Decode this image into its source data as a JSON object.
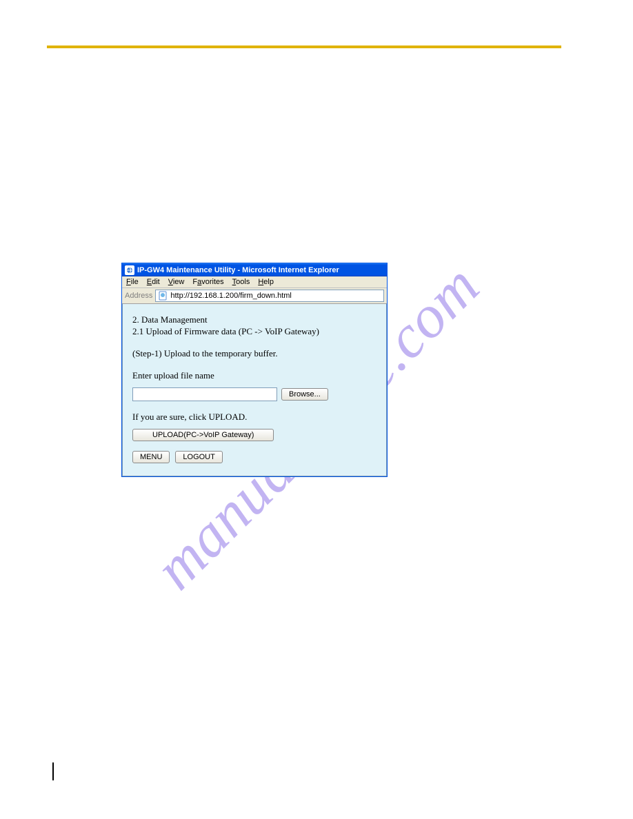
{
  "window": {
    "title": "IP-GW4 Maintenance Utility - Microsoft Internet Explorer"
  },
  "menubar": {
    "file": "File",
    "edit": "Edit",
    "view": "View",
    "favorites": "Favorites",
    "tools": "Tools",
    "help": "Help"
  },
  "addressbar": {
    "label": "Address",
    "url": "http://192.168.1.200/firm_down.html"
  },
  "page": {
    "heading1": "2. Data Management",
    "heading2": "2.1 Upload of Firmware data (PC -> VoIP Gateway)",
    "step": "(Step-1) Upload to the temporary buffer.",
    "enter_label": "Enter upload file name",
    "browse_label": "Browse...",
    "sure_text": "If you are sure, click UPLOAD.",
    "upload_label": "UPLOAD(PC->VoIP Gateway)",
    "menu_label": "MENU",
    "logout_label": "LOGOUT"
  },
  "watermark": "manualshive.com"
}
